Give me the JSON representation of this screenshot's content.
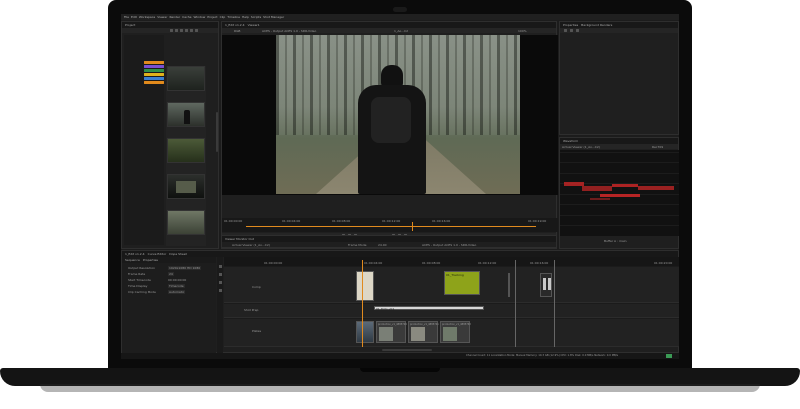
{
  "app": {
    "menu": [
      "File",
      "Edit",
      "Workspace",
      "Viewer",
      "Render",
      "Cache",
      "Window",
      "Project",
      "Clip",
      "Timeline",
      "Help",
      "Scripts",
      "Shot Manager"
    ]
  },
  "project_panel": {
    "tab": "Project",
    "color_badges": [
      "#e28a1c",
      "#7a4fd1",
      "#2f8f47",
      "#e0b21c",
      "#d13a3a",
      "#3a7fd1",
      "#e28a1c"
    ]
  },
  "viewer_panel": {
    "tabs": [
      "1_Edit v1.2.4",
      "Viewer1"
    ],
    "toolbar_left": "RGB",
    "color_space": "ACES - Output ACES 1.0 - SDR-Video",
    "frame_field": "1_Ao...C2",
    "zoom": "100%",
    "timecodes": [
      "01:00:00:00",
      "01:00:04:00",
      "01:00:08:00",
      "01:00:12:00",
      "01:00:16:00",
      "01:00:20:00"
    ],
    "start_tc": "01:00:00:00",
    "end_tc": "01:00:19:00",
    "current_tc": "01:00:18:18"
  },
  "viewer_bottom": {
    "tab": "Viewer Monitor Out",
    "clip_name": "Actual Viewer (1_Ao...C2)",
    "frame_mode": "Frame Mode",
    "fps": "24.00",
    "color_space": "ACES - Output ACES 1.0 - SDR-Video"
  },
  "properties_panel": {
    "tabs": [
      "Properties",
      "Background Renders"
    ]
  },
  "waveform_panel": {
    "tab": "Waveform",
    "source": "Actual Viewer (1_Ao...C2)",
    "channel": "Rec709",
    "buffer_label": "Buffer A : main"
  },
  "timeline": {
    "tabs": [
      "1_Edit v1.2.4",
      "Curve Editor",
      "Dope Sheet"
    ],
    "properties_tabs": [
      "Sequence",
      "Properties"
    ],
    "fields": [
      {
        "label": "Output Resolution",
        "value": "1920x1080 HD 1080"
      },
      {
        "label": "Frame Rate",
        "value": "24"
      },
      {
        "label": "Start Timecode",
        "value": "00:00:00:00"
      },
      {
        "label": "Time Display",
        "value": "Timecode"
      },
      {
        "label": "Clip Caching Mode",
        "value": "Automatic"
      }
    ],
    "ruler": [
      "01:00:00:00",
      "01:00:04:00",
      "01:00:08:00",
      "01:00:12:00",
      "01:00:16:00",
      "01:00:20:00"
    ],
    "tracks": [
      "Comp",
      "Shot Prep",
      "Plates"
    ],
    "clip_labels": [
      "01_Tracking",
      "01-Roto-v01",
      "production_v1_4885729",
      "production_v1_4885741",
      "production_v1_4885763"
    ],
    "highlight_color": "#8ea31a"
  },
  "status_bar": {
    "text": "Channel Count: 11  Localization Mode: Manual  Memory: 10.3 GB (12.9%)  CPU: 1.8%  Disk: 0.0 MB/s  Network: 0.0 MB/s"
  }
}
